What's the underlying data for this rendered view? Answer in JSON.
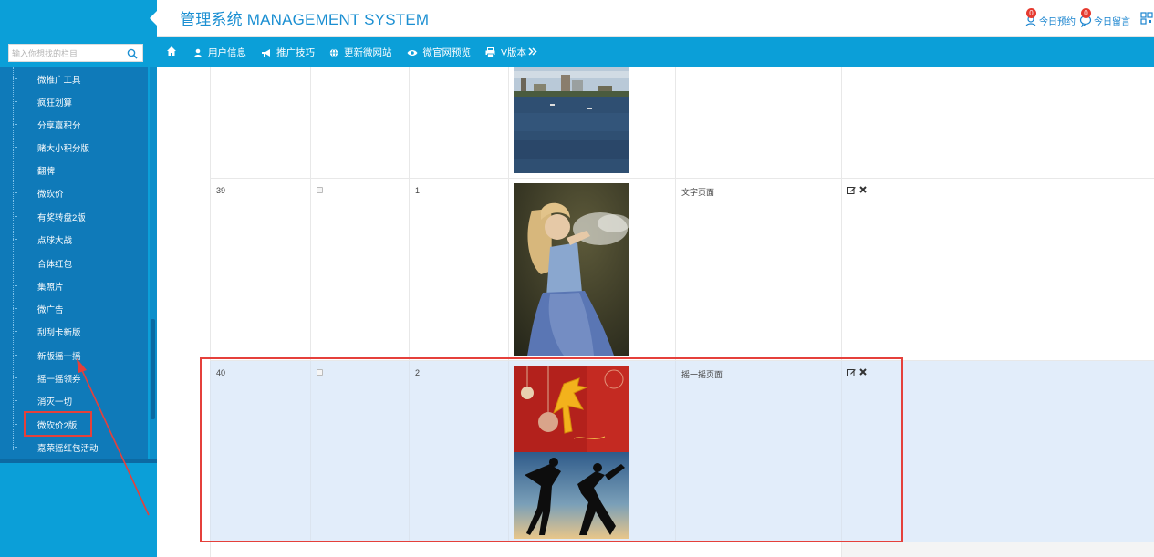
{
  "app": {
    "title": "管理系统 MANAGEMENT SYSTEM"
  },
  "top_right": {
    "appointments": {
      "label": "今日预约",
      "count": "0"
    },
    "messages": {
      "label": "今日留言",
      "count": "0"
    }
  },
  "search": {
    "placeholder": "输入你想找的栏目"
  },
  "nav": {
    "items": [
      {
        "label": "用户信息",
        "icon": "user-icon"
      },
      {
        "label": "推广技巧",
        "icon": "bullhorn-icon"
      },
      {
        "label": "更新微网站",
        "icon": "globe-icon"
      },
      {
        "label": "微官网预览",
        "icon": "eye-icon"
      },
      {
        "label": "V版本",
        "icon": "print-icon"
      }
    ]
  },
  "sidebar": {
    "items": [
      {
        "label": "微推广工具"
      },
      {
        "label": "疯狂划算"
      },
      {
        "label": "分享赢积分"
      },
      {
        "label": "赌大小积分版"
      },
      {
        "label": "翻牌"
      },
      {
        "label": "微砍价"
      },
      {
        "label": "有奖转盘2版"
      },
      {
        "label": "点球大战"
      },
      {
        "label": "合体红包"
      },
      {
        "label": "集照片"
      },
      {
        "label": "微广告"
      },
      {
        "label": "刮刮卡新版"
      },
      {
        "label": "新版摇一摇",
        "active": true
      },
      {
        "label": "摇一摇领券"
      },
      {
        "label": "消灭一切"
      },
      {
        "label": "微砍价2版"
      },
      {
        "label": "嘉荣摇红包活动"
      }
    ]
  },
  "table": {
    "rows": [
      {
        "id": "",
        "order": "",
        "type": "",
        "image": "lake-city-photo"
      },
      {
        "id": "39",
        "order": "1",
        "type": "文字页面",
        "image": "woman-blowing-snow-photo"
      },
      {
        "id": "40",
        "order": "2",
        "type": "摇一摇页面",
        "image": "new-year-and-kungfu-photo"
      }
    ]
  },
  "colors": {
    "primary": "#0b9fd8",
    "sidebar_dark": "#0f7ab9",
    "brand_text": "#1b8fd2",
    "highlight_row": "#e2edfa",
    "annotation_red": "#e5403b",
    "badge_red": "#e63a2f"
  }
}
